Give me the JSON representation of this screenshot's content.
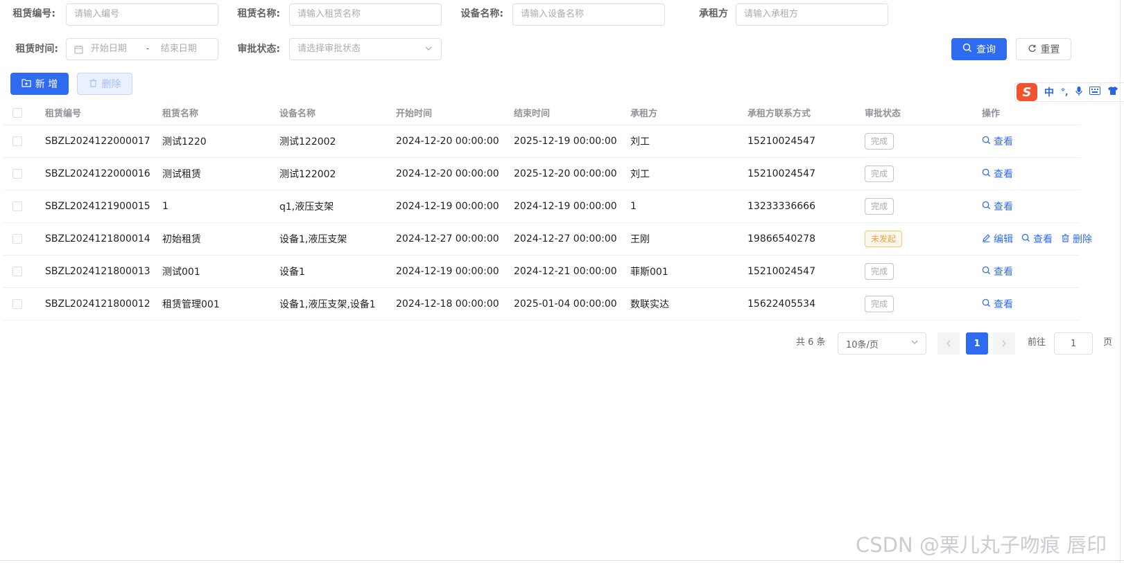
{
  "filters": {
    "lease_no": {
      "label": "租赁编号:",
      "placeholder": "请输入编号"
    },
    "lease_name": {
      "label": "租赁名称:",
      "placeholder": "请输入租赁名称"
    },
    "device_name": {
      "label": "设备名称:",
      "placeholder": "请输入设备名称"
    },
    "lessee": {
      "label": "承租方",
      "placeholder": "请输入承租方"
    },
    "lease_time": {
      "label": "租赁时间:",
      "start_placeholder": "开始日期",
      "separator": "-",
      "end_placeholder": "结束日期"
    },
    "approval_status": {
      "label": "审批状态:",
      "placeholder": "请选择审批状态"
    }
  },
  "buttons": {
    "query": "查询",
    "reset": "重置",
    "add": "新 增",
    "delete": "删除"
  },
  "table": {
    "headers": [
      "租赁编号",
      "租赁名称",
      "设备名称",
      "开始时间",
      "结束时间",
      "承租方",
      "承租方联系方式",
      "审批状态",
      "操作"
    ],
    "rows": [
      {
        "no": "SBZL2024122000017",
        "name": "测试1220",
        "device": "测试122002",
        "start": "2024-12-20 00:00:00",
        "end": "2025-12-19 00:00:00",
        "lessee": "刘工",
        "phone": "15210024547",
        "status": "完成",
        "status_type": "done"
      },
      {
        "no": "SBZL2024122000016",
        "name": "测试租赁",
        "device": "测试122002",
        "start": "2024-12-20 00:00:00",
        "end": "2025-12-20 00:00:00",
        "lessee": "刘工",
        "phone": "15210024547",
        "status": "完成",
        "status_type": "done"
      },
      {
        "no": "SBZL2024121900015",
        "name": "1",
        "device": "q1,液压支架",
        "start": "2024-12-19 00:00:00",
        "end": "2024-12-19 00:00:00",
        "lessee": "1",
        "phone": "13233336666",
        "status": "完成",
        "status_type": "done"
      },
      {
        "no": "SBZL2024121800014",
        "name": "初始租赁",
        "device": "设备1,液压支架",
        "start": "2024-12-27 00:00:00",
        "end": "2024-12-27 00:00:00",
        "lessee": "王刚",
        "phone": "19866540278",
        "status": "未发起",
        "status_type": "pending"
      },
      {
        "no": "SBZL2024121800013",
        "name": "测试001",
        "device": "设备1",
        "start": "2024-12-19 00:00:00",
        "end": "2024-12-21 00:00:00",
        "lessee": "菲斯001",
        "phone": "15210024547",
        "status": "完成",
        "status_type": "done"
      },
      {
        "no": "SBZL2024121800012",
        "name": "租赁管理001",
        "device": "设备1,液压支架,设备1",
        "start": "2024-12-18 00:00:00",
        "end": "2025-01-04 00:00:00",
        "lessee": "数联实达",
        "phone": "15622405534",
        "status": "完成",
        "status_type": "done"
      }
    ],
    "actions": {
      "edit": "编辑",
      "view": "查看",
      "delete": "删除"
    }
  },
  "pagination": {
    "total_text": "共 6 条",
    "page_size": "10条/页",
    "current_page": "1",
    "goto_label": "前往",
    "goto_value": "1",
    "page_unit": "页"
  },
  "ime": {
    "mode": "中",
    "punct": "°,"
  },
  "watermark": "CSDN @栗儿丸子吻痕 唇印",
  "colors": {
    "primary": "#2f6bf1",
    "pending": "#e6a23c",
    "ime_logo": "#f0532d"
  }
}
